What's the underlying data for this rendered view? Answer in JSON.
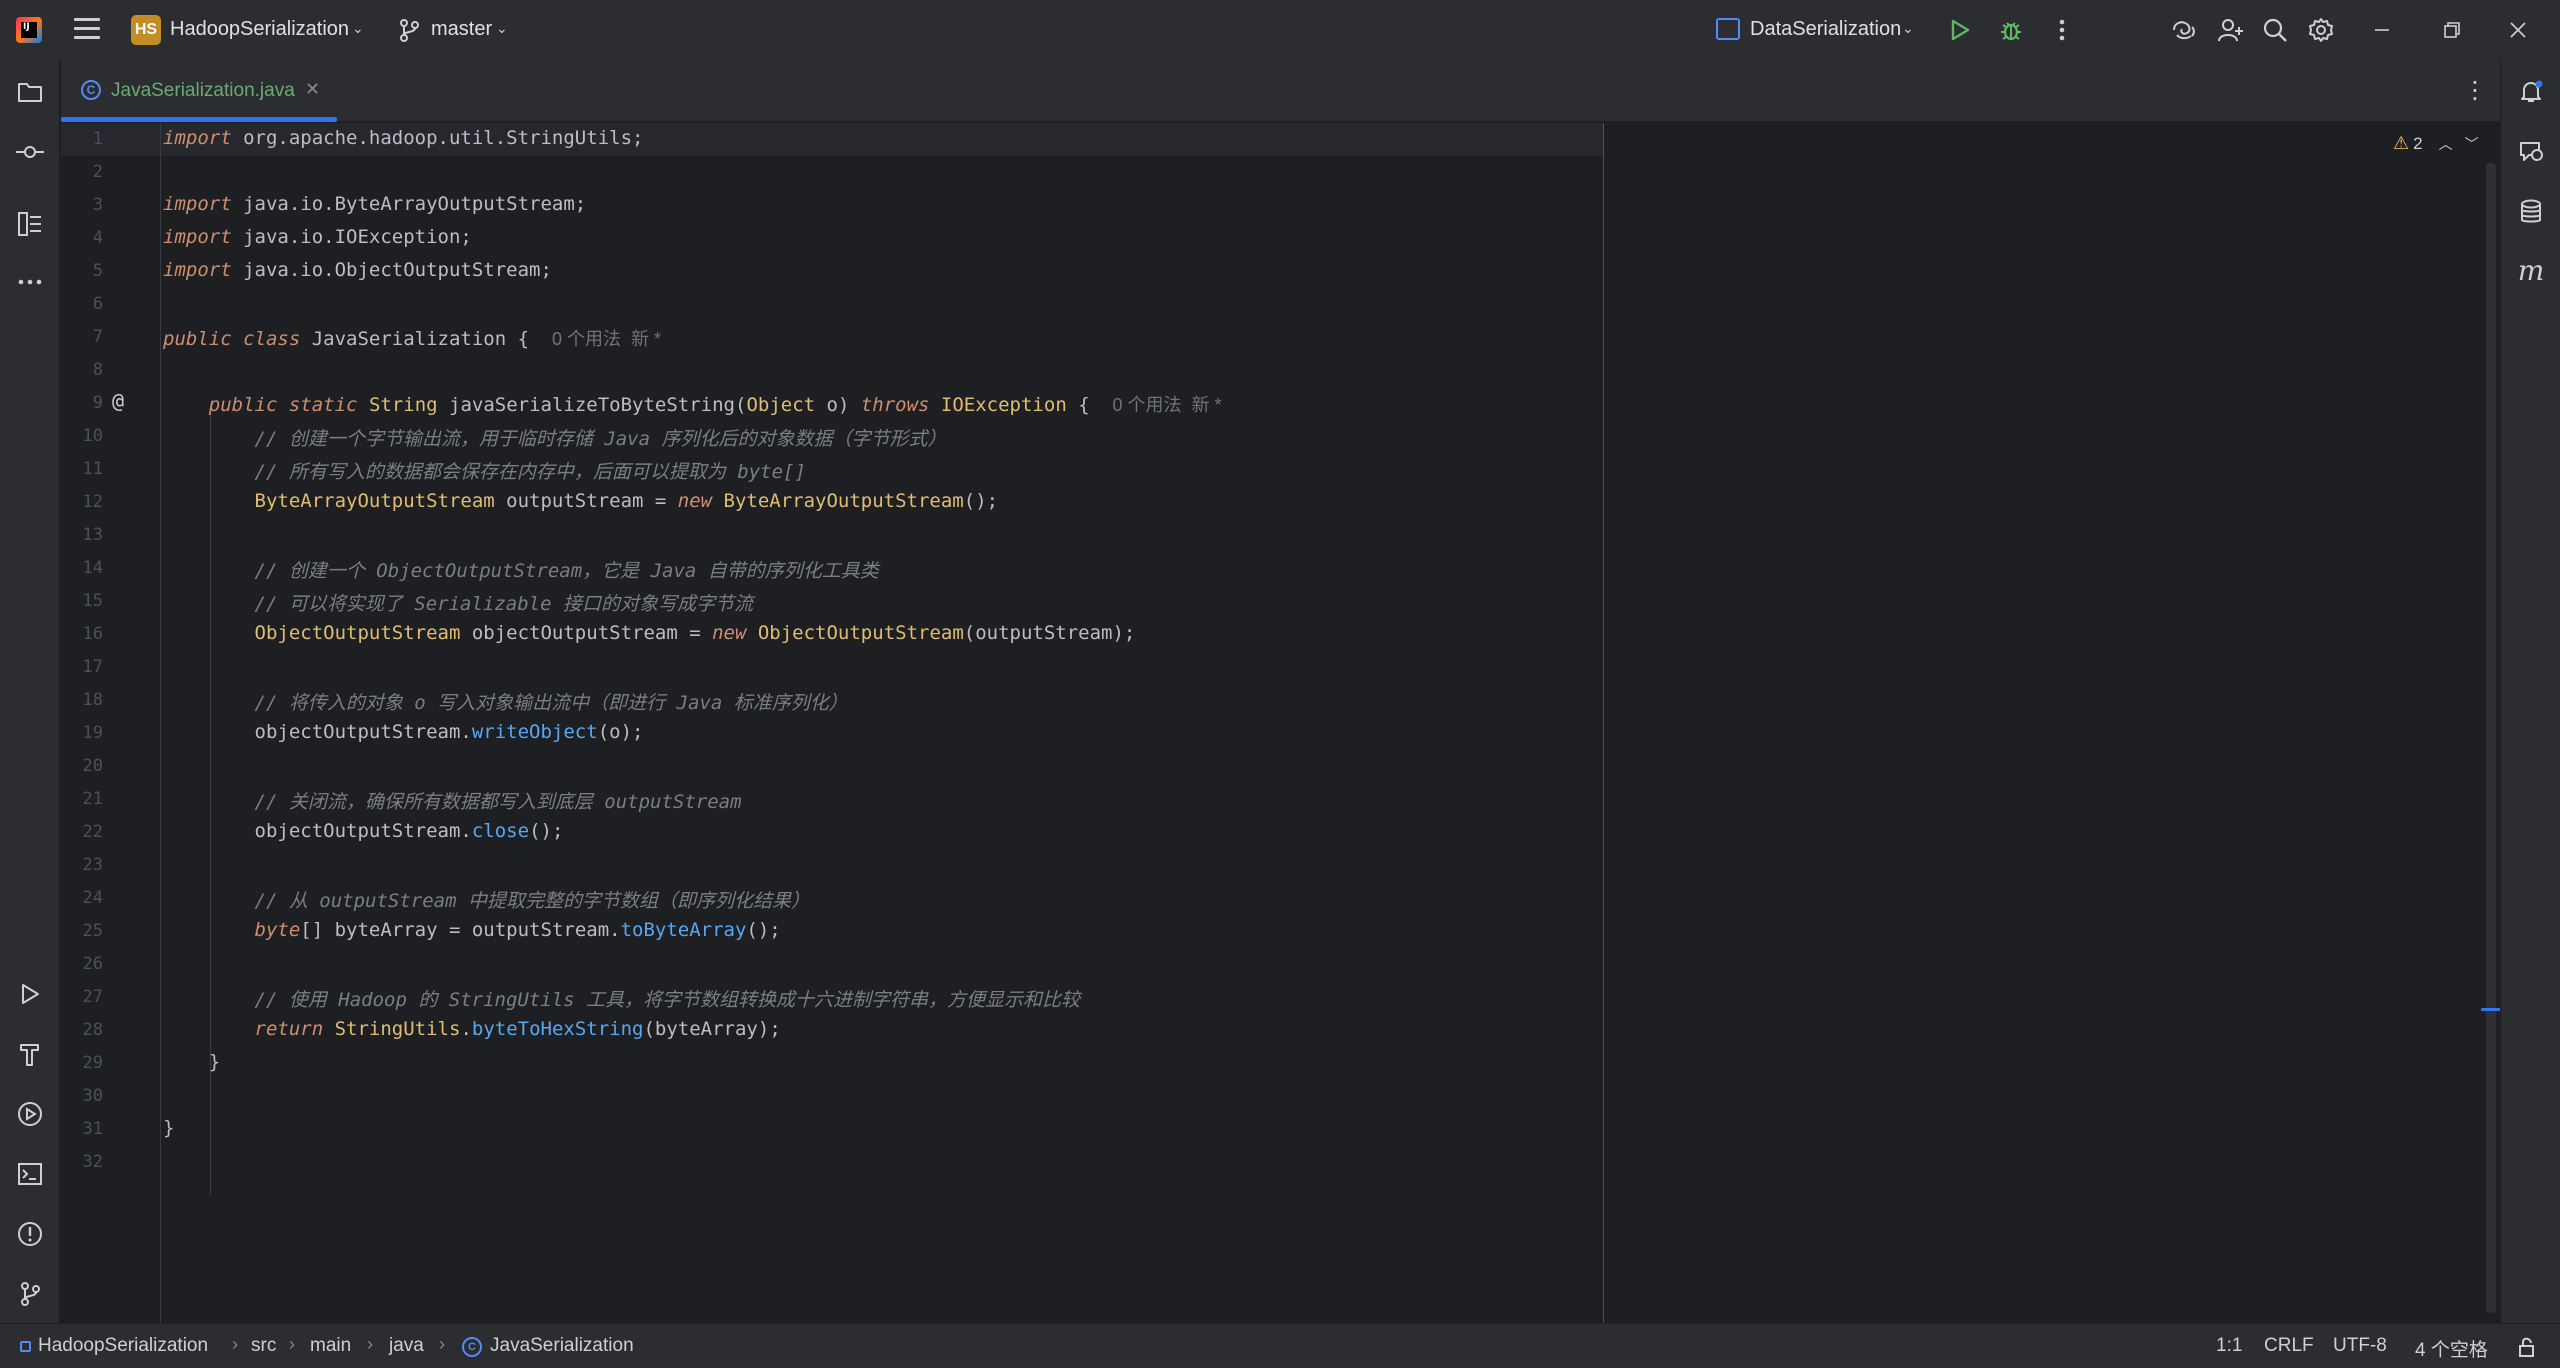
{
  "titlebar": {
    "project_badge": "HS",
    "project_name": "HadoopSerialization",
    "branch": "master",
    "run_config": "DataSerialization"
  },
  "tabs": [
    {
      "label": "JavaSerialization.java",
      "icon": "class-icon",
      "active": true
    }
  ],
  "editor": {
    "warnings_count": "2",
    "line_numbers": [
      "1",
      "2",
      "3",
      "4",
      "5",
      "6",
      "7",
      "8",
      "9",
      "10",
      "11",
      "12",
      "13",
      "14",
      "15",
      "16",
      "17",
      "18",
      "19",
      "20",
      "21",
      "22",
      "23",
      "24",
      "25",
      "26",
      "27",
      "28",
      "29",
      "30",
      "31",
      "32"
    ],
    "code": {
      "l1_kw": "import",
      "l1_rest": " org.apache.hadoop.util.StringUtils;",
      "l3_kw": "import",
      "l3_rest": " java.io.ByteArrayOutputStream;",
      "l4_kw": "import",
      "l4_rest": " java.io.IOException;",
      "l5_kw": "import",
      "l5_rest": " java.io.ObjectOutputStream;",
      "l7_kw": "public class",
      "l7_name": " JavaSerialization {",
      "l7_hint": "0 个用法  新 *",
      "l9_kw": "public static",
      "l9_type": "String",
      "l9_name": " javaSerializeToByteString(",
      "l9_ptype": "Object",
      "l9_param": " o) ",
      "l9_throws": "throws",
      "l9_exc": " IOException",
      "l9_brace": " {",
      "l9_hint": "0 个用法  新 *",
      "l10": "// 创建一个字节输出流，用于临时存储 Java 序列化后的对象数据（字节形式）",
      "l11": "// 所有写入的数据都会保存在内存中，后面可以提取为 byte[]",
      "l12_type": "ByteArrayOutputStream",
      "l12_mid": " outputStream = ",
      "l12_new": "new",
      "l12_ctor": " ByteArrayOutputStream",
      "l12_end": "();",
      "l14": "// 创建一个 ObjectOutputStream，它是 Java 自带的序列化工具类",
      "l15": "// 可以将实现了 Serializable 接口的对象写成字节流",
      "l16_type": "ObjectOutputStream",
      "l16_mid": " objectOutputStream = ",
      "l16_new": "new",
      "l16_ctor": " ObjectOutputStream",
      "l16_end": "(outputStream);",
      "l18": "// 将传入的对象 o 写入对象输出流中（即进行 Java 标准序列化）",
      "l19_obj": "objectOutputStream.",
      "l19_method": "writeObject",
      "l19_end": "(o);",
      "l21": "// 关闭流，确保所有数据都写入到底层 outputStream",
      "l22_obj": "objectOutputStream.",
      "l22_method": "close",
      "l22_end": "();",
      "l24": "// 从 outputStream 中提取完整的字节数组（即序列化结果）",
      "l25_kw": "byte",
      "l25_mid": "[] byteArray = outputStream.",
      "l25_method": "toByteArray",
      "l25_end": "();",
      "l27": "// 使用 Hadoop 的 StringUtils 工具，将字节数组转换成十六进制字符串，方便显示和比较",
      "l28_kw": "return",
      "l28_cls": " StringUtils",
      "l28_dot": ".",
      "l28_method": "byteToHexString",
      "l28_end": "(byteArray);",
      "l29": "}",
      "l31": "}"
    }
  },
  "statusbar": {
    "breadcrumbs": [
      "HadoopSerialization",
      "src",
      "main",
      "java",
      "JavaSerialization"
    ],
    "position": "1:1",
    "line_sep": "CRLF",
    "encoding": "UTF-8",
    "indent": "4 个空格"
  }
}
